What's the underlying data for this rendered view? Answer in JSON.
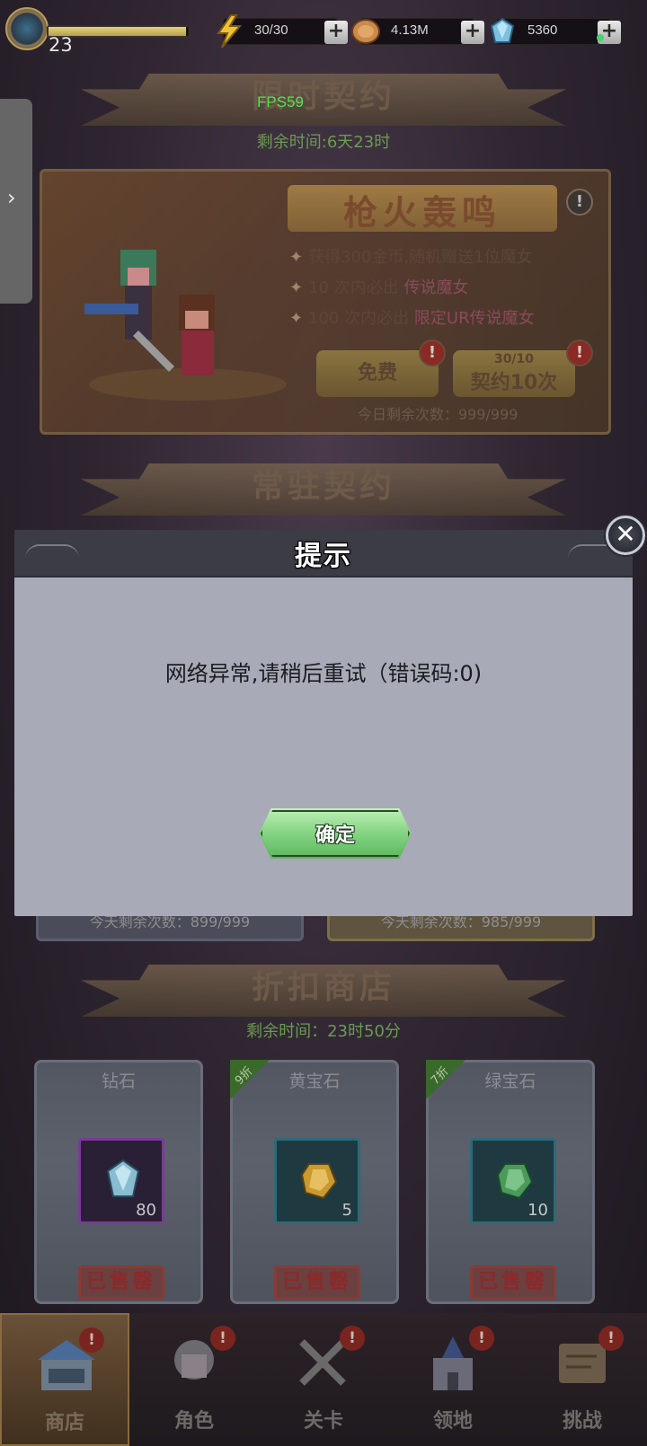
{
  "status_bar": {
    "level": "23",
    "xp_fraction": 0.98,
    "energy": "30/30",
    "gold": "4.13M",
    "diamonds": "5360",
    "plus": "+"
  },
  "fps": "FPS59",
  "side_tab": {
    "arrow": "›"
  },
  "limited_contract": {
    "title": "限时契约",
    "remaining": "剩余时间:6天23时",
    "banner_title": "枪火轰鸣",
    "info": "!",
    "perks": [
      {
        "prefix": "获得300金币,随机赠送1位魔女",
        "highlight": ""
      },
      {
        "prefix": "10 次内必出 ",
        "highlight": "传说魔女"
      },
      {
        "prefix": "100 次内必出 ",
        "highlight": "限定UR传说魔女"
      }
    ],
    "free_button": "免费",
    "contract10_cost": "30/10",
    "contract10_button": "契约10次",
    "badge": "!",
    "today_remaining": "今日剩余次数：999/999"
  },
  "regular_contract": {
    "title": "常驻契约",
    "left_remaining": "今天剩余次数：899/999",
    "right_remaining": "今天剩余次数：985/999"
  },
  "discount_shop": {
    "title": "折扣商店",
    "remaining": "剩余时间：23时50分",
    "items": [
      {
        "name": "钻石",
        "qty": "80",
        "tag": "",
        "sold": "已售罄"
      },
      {
        "name": "黄宝石",
        "qty": "5",
        "tag": "9折",
        "sold": "已售罄"
      },
      {
        "name": "绿宝石",
        "qty": "10",
        "tag": "7折",
        "sold": "已售罄"
      }
    ]
  },
  "dialog": {
    "title": "提示",
    "message": "网络异常,请稍后重试（错误码:0)",
    "ok": "确定",
    "close": "✕"
  },
  "bottom_nav": [
    {
      "label": "商店",
      "badge": "!"
    },
    {
      "label": "角色",
      "badge": "!"
    },
    {
      "label": "关卡",
      "badge": "!"
    },
    {
      "label": "领地",
      "badge": "!"
    },
    {
      "label": "挑战",
      "badge": "!"
    }
  ]
}
